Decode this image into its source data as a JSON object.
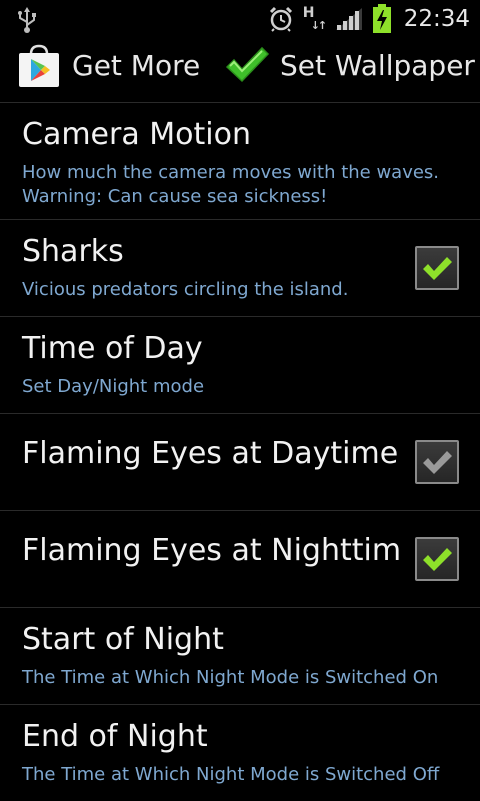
{
  "status_bar": {
    "time": "22:34",
    "network_type": "H",
    "icons": [
      "usb-icon",
      "alarm-icon",
      "hspa-icon",
      "signal-icon",
      "battery-charging-icon"
    ]
  },
  "action_bar": {
    "get_more_label": "Get More",
    "set_wallpaper_label": "Set Wallpaper"
  },
  "preferences": [
    {
      "title": "Camera Motion",
      "summary": "How much the camera moves with the waves. Warning: Can cause sea sickness!",
      "has_checkbox": false
    },
    {
      "title": "Sharks",
      "summary": "Vicious predators circling the island.",
      "has_checkbox": true,
      "checked": true,
      "enabled": true
    },
    {
      "title": "Time of Day",
      "summary": "Set Day/Night mode",
      "has_checkbox": false
    },
    {
      "title": "Flaming Eyes at Daytime",
      "summary": "",
      "has_checkbox": true,
      "checked": true,
      "enabled": false
    },
    {
      "title": "Flaming Eyes at Nighttime",
      "summary": "",
      "has_checkbox": true,
      "checked": true,
      "enabled": true
    },
    {
      "title": "Start of Night",
      "summary": "The Time at Which Night Mode is Switched On",
      "has_checkbox": false
    },
    {
      "title": "End of Night",
      "summary": "The Time at Which Night Mode is Switched Off",
      "has_checkbox": false
    }
  ],
  "colors": {
    "background": "#000000",
    "title_text": "#f2f2f2",
    "summary_text": "#7fa8d0",
    "divider": "#2a2a2a",
    "check_active": "#8ee02a",
    "check_disabled": "#9a9a9a",
    "battery_charging": "#8ee02a"
  }
}
